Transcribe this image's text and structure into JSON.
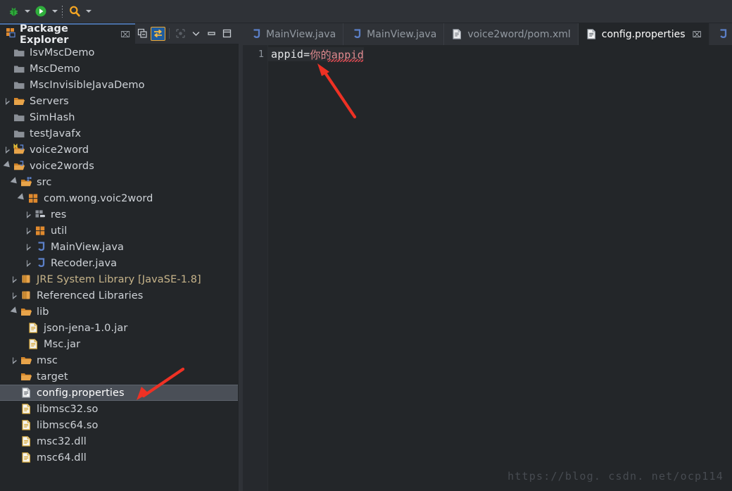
{
  "toolbar": {
    "items": [
      {
        "icon": "debug-bug-icon",
        "label": "Debug",
        "has_dropdown": true
      },
      {
        "icon": "run-play-icon",
        "label": "Run",
        "has_dropdown": true
      },
      {
        "icon": "search-icon",
        "label": "Search",
        "has_dropdown": true
      }
    ]
  },
  "package_explorer": {
    "title": "Package Explorer",
    "close_label": "⌧",
    "tools": [
      {
        "icon": "collapse-all-icon",
        "label": "Collapse All",
        "active": false
      },
      {
        "icon": "link-with-editor-icon",
        "label": "Link with Editor",
        "active": true
      },
      {
        "icon": "focus-on-active-task-icon",
        "label": "Focus on Active Task",
        "active": false
      },
      {
        "icon": "view-menu-chevron-down-icon",
        "label": "View Menu",
        "active": false
      },
      {
        "icon": "minimize-icon",
        "label": "Minimize",
        "active": false
      },
      {
        "icon": "maximize-icon",
        "label": "Maximize",
        "active": false
      }
    ],
    "tree": [
      {
        "label": "IsvMscDemo",
        "indent": 1,
        "twisty": "none",
        "icon": "folder-closed-grey-icon",
        "selected": false
      },
      {
        "label": "MscDemo",
        "indent": 1,
        "twisty": "none",
        "icon": "folder-closed-grey-icon",
        "selected": false
      },
      {
        "label": "MscInvisibleJavaDemo",
        "indent": 1,
        "twisty": "none",
        "icon": "folder-closed-grey-icon",
        "selected": false
      },
      {
        "label": "Servers",
        "indent": 1,
        "twisty": "closed",
        "icon": "folder-open-orange-icon",
        "selected": false
      },
      {
        "label": "SimHash",
        "indent": 1,
        "twisty": "none",
        "icon": "folder-closed-grey-icon",
        "selected": false
      },
      {
        "label": "testJavafx",
        "indent": 1,
        "twisty": "none",
        "icon": "folder-closed-grey-icon",
        "selected": false
      },
      {
        "label": "voice2word",
        "indent": 1,
        "twisty": "closed",
        "icon": "maven-java-project-icon",
        "selected": false
      },
      {
        "label": "voice2words",
        "indent": 1,
        "twisty": "open",
        "icon": "java-project-icon",
        "selected": false
      },
      {
        "label": "src",
        "indent": 2,
        "twisty": "open",
        "icon": "source-folder-icon",
        "selected": false
      },
      {
        "label": "com.wong.voic2word",
        "indent": 3,
        "twisty": "open",
        "icon": "package-icon",
        "selected": false
      },
      {
        "label": "res",
        "indent": 4,
        "twisty": "closed",
        "icon": "package-empty-icon",
        "selected": false
      },
      {
        "label": "util",
        "indent": 4,
        "twisty": "closed",
        "icon": "package-icon",
        "selected": false
      },
      {
        "label": "MainView.java",
        "indent": 4,
        "twisty": "closed",
        "icon": "java-file-icon",
        "selected": false
      },
      {
        "label": "Recoder.java",
        "indent": 4,
        "twisty": "closed",
        "icon": "java-file-icon",
        "selected": false
      },
      {
        "label": "JRE System Library [JavaSE-1.8]",
        "indent": 2,
        "twisty": "closed",
        "icon": "library-icon",
        "selected": false,
        "dim": true
      },
      {
        "label": "Referenced Libraries",
        "indent": 2,
        "twisty": "closed",
        "icon": "library-icon",
        "selected": false
      },
      {
        "label": "lib",
        "indent": 2,
        "twisty": "open",
        "icon": "folder-open-orange-icon",
        "selected": false
      },
      {
        "label": "json-jena-1.0.jar",
        "indent": 3,
        "twisty": "none",
        "icon": "jar-file-icon",
        "selected": false
      },
      {
        "label": "Msc.jar",
        "indent": 3,
        "twisty": "none",
        "icon": "jar-file-icon",
        "selected": false
      },
      {
        "label": "msc",
        "indent": 2,
        "twisty": "closed",
        "icon": "folder-open-orange-icon",
        "selected": false
      },
      {
        "label": "target",
        "indent": 2,
        "twisty": "none",
        "icon": "folder-open-orange-icon",
        "selected": false
      },
      {
        "label": "config.properties",
        "indent": 2,
        "twisty": "none",
        "icon": "properties-file-icon",
        "selected": true
      },
      {
        "label": "libmsc32.so",
        "indent": 2,
        "twisty": "none",
        "icon": "generic-file-icon",
        "selected": false
      },
      {
        "label": "libmsc64.so",
        "indent": 2,
        "twisty": "none",
        "icon": "generic-file-icon",
        "selected": false
      },
      {
        "label": "msc32.dll",
        "indent": 2,
        "twisty": "none",
        "icon": "generic-file-icon",
        "selected": false
      },
      {
        "label": "msc64.dll",
        "indent": 2,
        "twisty": "none",
        "icon": "generic-file-icon",
        "selected": false
      }
    ]
  },
  "editor": {
    "tabs": [
      {
        "label": "MainView.java",
        "icon": "java-file-icon",
        "active": false,
        "closable": false
      },
      {
        "label": "MainView.java",
        "icon": "java-file-icon",
        "active": false,
        "closable": false
      },
      {
        "label": "voice2word/pom.xml",
        "icon": "xml-file-icon",
        "active": false,
        "closable": false
      },
      {
        "label": "config.properties",
        "icon": "properties-file-icon",
        "active": true,
        "closable": true,
        "close_label": "⌧"
      },
      {
        "label": "",
        "icon": "java-file-icon",
        "active": false,
        "closable": false
      }
    ],
    "line_number": "1",
    "code": {
      "key": "appid=",
      "value": "你的appid"
    }
  },
  "annotations": [
    {
      "name": "arrow-to-code",
      "color": "#ee3124"
    },
    {
      "name": "arrow-to-config-file",
      "color": "#ee3124"
    }
  ],
  "watermark": {
    "text": "https://blog. csdn. net/ocp114"
  },
  "colors": {
    "window_bg": "#232629",
    "chrome_bg": "#2f3237",
    "selection_bg": "#4a4f57",
    "text": "#cfd3d8",
    "accent_orange": "#f0a830",
    "accent_blue": "#5b7fc7",
    "annotation_red": "#ee3124",
    "code_value": "#e08a8f"
  }
}
